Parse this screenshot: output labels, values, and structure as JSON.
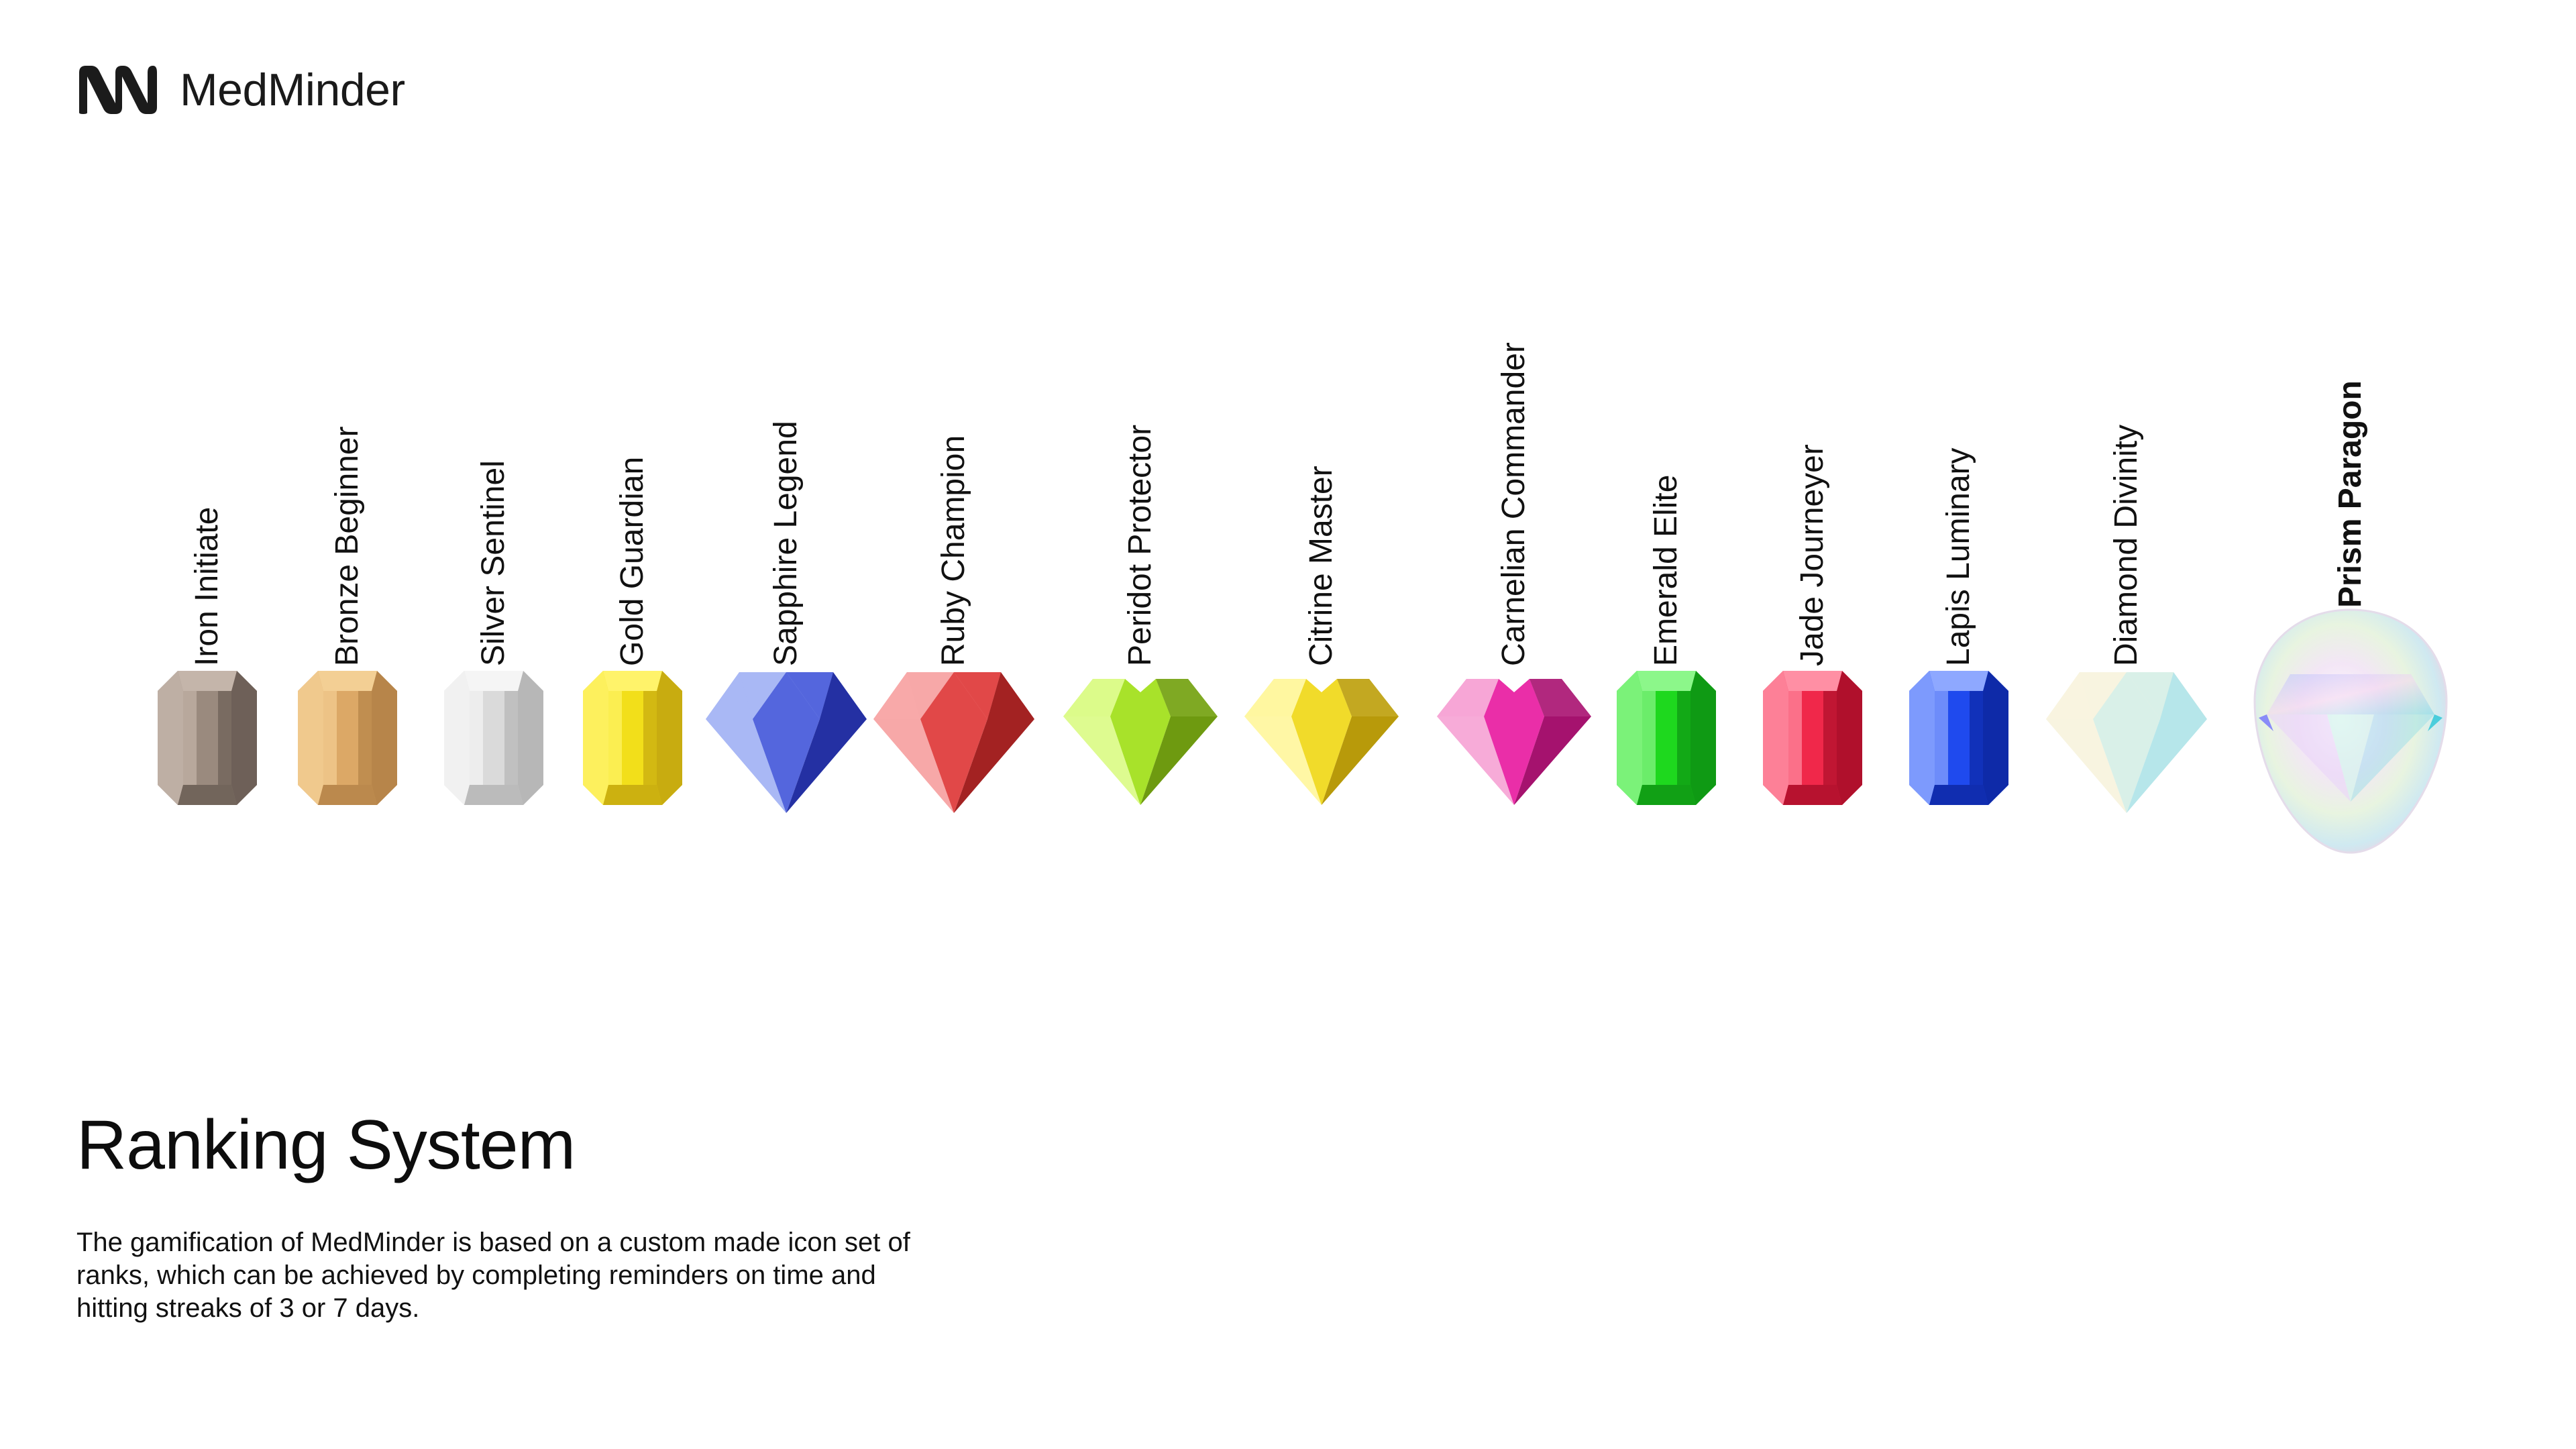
{
  "brand": {
    "name": "MedMinder",
    "logo_icon": "medminder-logo-icon"
  },
  "ranks": [
    {
      "label": "Iron Initiate",
      "shape": "octagon",
      "colors": {
        "light": "#c4b5aa",
        "mid": "#9a8a7e",
        "dark": "#6e6058"
      }
    },
    {
      "label": "Bronze Beginner",
      "shape": "octagon",
      "colors": {
        "light": "#f3cf94",
        "mid": "#dca866",
        "dark": "#b7854a"
      }
    },
    {
      "label": "Silver Sentinel",
      "shape": "octagon",
      "colors": {
        "light": "#f5f5f5",
        "mid": "#dadada",
        "dark": "#b7b7b7"
      }
    },
    {
      "label": "Gold Guardian",
      "shape": "octagon",
      "colors": {
        "light": "#fff36a",
        "mid": "#f2df1a",
        "dark": "#c8ac10"
      }
    },
    {
      "label": "Sapphire Legend",
      "shape": "diamond",
      "colors": {
        "light": "#a9b8f5",
        "mid": "#5466dd",
        "dark": "#2430a3"
      }
    },
    {
      "label": "Ruby Champion",
      "shape": "diamond",
      "colors": {
        "light": "#f7a8a8",
        "mid": "#e14848",
        "dark": "#a32222"
      }
    },
    {
      "label": "Peridot Protector",
      "shape": "heart",
      "colors": {
        "light": "#dcfb8a",
        "mid": "#a8e22a",
        "dark": "#6e9a10"
      }
    },
    {
      "label": "Citrine Master",
      "shape": "heart",
      "colors": {
        "light": "#fff7a0",
        "mid": "#f1db2a",
        "dark": "#b89a0a"
      }
    },
    {
      "label": "Carnelian Commander",
      "shape": "heart",
      "colors": {
        "light": "#f7a6d6",
        "mid": "#ea2ea8",
        "dark": "#a5126e"
      }
    },
    {
      "label": "Emerald Elite",
      "shape": "octagon",
      "colors": {
        "light": "#8cf78a",
        "mid": "#1ed81e",
        "dark": "#0f9a14"
      }
    },
    {
      "label": "Jade Journeyer",
      "shape": "octagon",
      "colors": {
        "light": "#ff8fa4",
        "mid": "#f0284a",
        "dark": "#b0102c"
      }
    },
    {
      "label": "Lapis Luminary",
      "shape": "octagon",
      "colors": {
        "light": "#8ea8ff",
        "mid": "#1f4aee",
        "dark": "#0e2aa8"
      }
    },
    {
      "label": "Diamond Divinity",
      "shape": "diamond",
      "colors": {
        "light": "#f8f4e0",
        "mid": "#d9f0e8",
        "dark": "#b6e6ea"
      }
    },
    {
      "label": "Prism Paragon",
      "shape": "prism",
      "bold": true,
      "colors": {
        "light": "#f3e6f6",
        "mid": "#cfe9f1",
        "dark": "#79d6e8"
      }
    }
  ],
  "section": {
    "title": "Ranking System",
    "description": "The gamification of MedMinder is based on a custom made icon set of ranks, which can be achieved by completing reminders on time and hitting streaks of 3 or 7 days."
  }
}
